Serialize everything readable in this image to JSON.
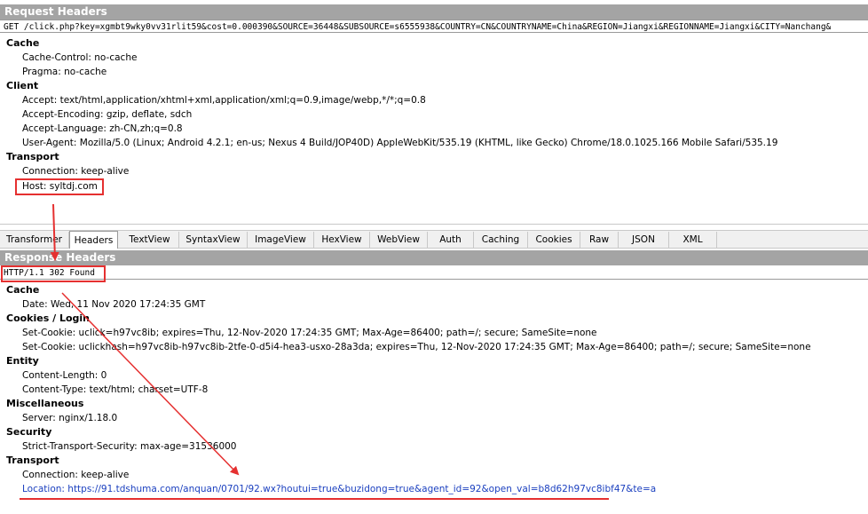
{
  "request": {
    "header_title": "Request Headers",
    "request_line": "GET /click.php?key=xgmbt9wky0vv31rlit59&cost=0.000390&SOURCE=36448&SUBSOURCE=s6555938&COUNTRY=CN&COUNTRYNAME=China&REGION=Jiangxi&REGIONNAME=Jiangxi&CITY=Nanchang&",
    "groups": [
      {
        "name": "Cache",
        "headers": [
          "Cache-Control: no-cache",
          "Pragma: no-cache"
        ]
      },
      {
        "name": "Client",
        "headers": [
          "Accept: text/html,application/xhtml+xml,application/xml;q=0.9,image/webp,*/*;q=0.8",
          "Accept-Encoding: gzip, deflate, sdch",
          "Accept-Language: zh-CN,zh;q=0.8",
          "User-Agent: Mozilla/5.0 (Linux; Android 4.2.1; en-us; Nexus 4 Build/JOP40D) AppleWebKit/535.19 (KHTML, like Gecko) Chrome/18.0.1025.166 Mobile Safari/535.19"
        ]
      },
      {
        "name": "Transport",
        "headers": [
          "Connection: keep-alive",
          "Host: syltdj.com"
        ]
      }
    ]
  },
  "tabs": [
    "Transformer",
    "Headers",
    "TextView",
    "SyntaxView",
    "ImageView",
    "HexView",
    "WebView",
    "Auth",
    "Caching",
    "Cookies",
    "Raw",
    "JSON",
    "XML"
  ],
  "active_tab": "Headers",
  "response": {
    "header_title": "Response Headers",
    "status_line": "HTTP/1.1 302 Found",
    "groups": [
      {
        "name": "Cache",
        "headers": [
          "Date: Wed, 11 Nov 2020 17:24:35 GMT"
        ]
      },
      {
        "name": "Cookies / Login",
        "headers": [
          "Set-Cookie: uclick=h97vc8ib; expires=Thu, 12-Nov-2020 17:24:35 GMT; Max-Age=86400; path=/; secure; SameSite=none",
          "Set-Cookie: uclickhash=h97vc8ib-h97vc8ib-2tfe-0-d5i4-hea3-usxo-28a3da; expires=Thu, 12-Nov-2020 17:24:35 GMT; Max-Age=86400; path=/; secure; SameSite=none"
        ]
      },
      {
        "name": "Entity",
        "headers": [
          "Content-Length: 0",
          "Content-Type: text/html; charset=UTF-8"
        ]
      },
      {
        "name": "Miscellaneous",
        "headers": [
          "Server: nginx/1.18.0"
        ]
      },
      {
        "name": "Security",
        "headers": [
          "Strict-Transport-Security: max-age=31536000"
        ]
      },
      {
        "name": "Transport",
        "headers": [
          "Connection: keep-alive"
        ]
      }
    ],
    "location_line": "Location: https://91.tdshuma.com/anquan/0701/92.wx?houtui=true&buzidong=true&agent_id=92&open_val=b8d62h97vc8ibf47&te=a"
  },
  "colors": {
    "section_header_bg": "#a4a4a4",
    "annotation_red": "#e53030",
    "link_blue": "#1a3fbf"
  }
}
